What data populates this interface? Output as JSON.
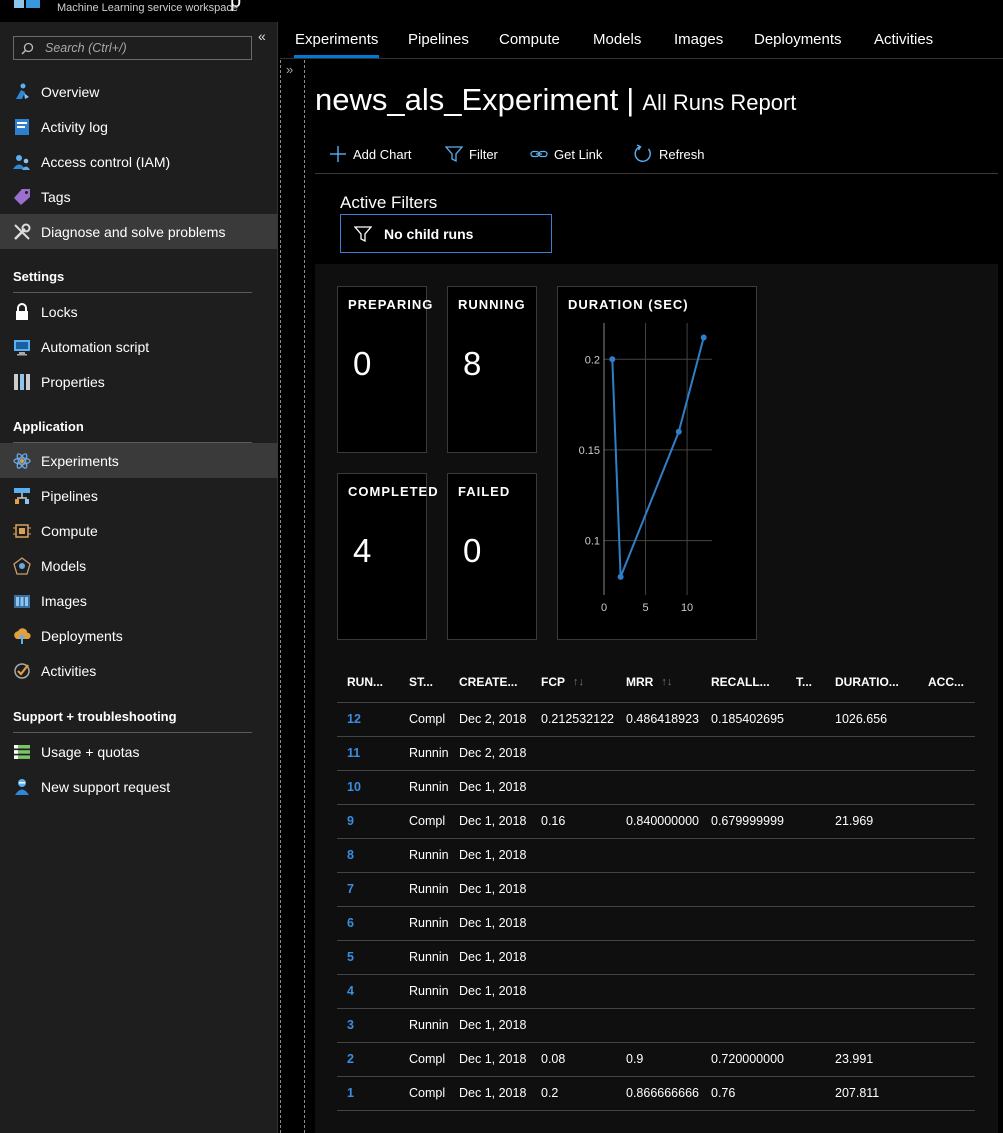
{
  "header": {
    "subtitle": "Machine Learning service workspace",
    "title_fragment": "p"
  },
  "sidebar": {
    "search_placeholder": "Search (Ctrl+/)",
    "collapse_glyph": "«",
    "items_top": [
      {
        "label": "Overview",
        "icon": "overview-icon"
      },
      {
        "label": "Activity log",
        "icon": "activity-log-icon"
      },
      {
        "label": "Access control (IAM)",
        "icon": "access-control-icon"
      },
      {
        "label": "Tags",
        "icon": "tag-icon"
      },
      {
        "label": "Diagnose and solve problems",
        "icon": "wrench-icon"
      }
    ],
    "settings": {
      "heading": "Settings",
      "items": [
        {
          "label": "Locks",
          "icon": "lock-icon"
        },
        {
          "label": "Automation script",
          "icon": "automation-script-icon"
        },
        {
          "label": "Properties",
          "icon": "properties-icon"
        }
      ]
    },
    "application": {
      "heading": "Application",
      "items": [
        {
          "label": "Experiments",
          "icon": "experiments-icon"
        },
        {
          "label": "Pipelines",
          "icon": "pipelines-icon"
        },
        {
          "label": "Compute",
          "icon": "compute-icon"
        },
        {
          "label": "Models",
          "icon": "models-icon"
        },
        {
          "label": "Images",
          "icon": "images-icon"
        },
        {
          "label": "Deployments",
          "icon": "deployments-icon"
        },
        {
          "label": "Activities",
          "icon": "activities-icon"
        }
      ]
    },
    "support": {
      "heading": "Support + troubleshooting",
      "items": [
        {
          "label": "Usage + quotas",
          "icon": "usage-quotas-icon"
        },
        {
          "label": "New support request",
          "icon": "support-request-icon"
        }
      ]
    }
  },
  "tabs": [
    "Experiments",
    "Pipelines",
    "Compute",
    "Models",
    "Images",
    "Deployments",
    "Activities"
  ],
  "active_tab": "Experiments",
  "splitter_glyph": "»",
  "page": {
    "title": "news_als_Experiment",
    "separator": "|",
    "subtitle": "All Runs Report"
  },
  "toolbar": {
    "add_chart": "Add Chart",
    "filter": "Filter",
    "get_link": "Get Link",
    "refresh": "Refresh"
  },
  "filters": {
    "label": "Active Filters",
    "chip": "No child runs"
  },
  "tiles": {
    "preparing": {
      "label": "PREPARING",
      "value": "0"
    },
    "running": {
      "label": "RUNNING",
      "value": "8"
    },
    "completed": {
      "label": "COMPLETED",
      "value": "4"
    },
    "failed": {
      "label": "FAILED",
      "value": "0"
    }
  },
  "chart_data": {
    "type": "line",
    "title": "DURATION (SEC)",
    "x": [
      1,
      2,
      9,
      12
    ],
    "y": [
      0.2,
      0.08,
      0.16,
      0.212
    ],
    "xticks": [
      "0",
      "5",
      "10"
    ],
    "yticks": [
      "0.1",
      "0.15",
      "0.2"
    ],
    "xlim": [
      0,
      13
    ],
    "ylim": [
      0.07,
      0.22
    ],
    "grid": true,
    "color": "#2f7fc8"
  },
  "table": {
    "headers": [
      {
        "label": "RUN...",
        "sortable": false
      },
      {
        "label": "ST...",
        "sortable": false
      },
      {
        "label": "CREATE...",
        "sortable": false
      },
      {
        "label": "FCP",
        "sortable": true
      },
      {
        "label": "MRR",
        "sortable": true
      },
      {
        "label": "RECALL...",
        "sortable": false
      },
      {
        "label": "T...",
        "sortable": false
      },
      {
        "label": "DURATIO...",
        "sortable": false
      },
      {
        "label": "ACC...",
        "sortable": false
      }
    ],
    "sort_glyph": "↑↓",
    "rows": [
      {
        "run": "12",
        "status": "Compl",
        "created": "Dec 2, 2018",
        "fcp": "0.212532122",
        "mrr": "0.486418923",
        "recall": "0.185402695",
        "t": "",
        "duration": "1026.656",
        "acc": ""
      },
      {
        "run": "11",
        "status": "Runnin",
        "created": "Dec 2, 2018",
        "fcp": "",
        "mrr": "",
        "recall": "",
        "t": "",
        "duration": "",
        "acc": ""
      },
      {
        "run": "10",
        "status": "Runnin",
        "created": "Dec 1, 2018",
        "fcp": "",
        "mrr": "",
        "recall": "",
        "t": "",
        "duration": "",
        "acc": ""
      },
      {
        "run": "9",
        "status": "Compl",
        "created": "Dec 1, 2018",
        "fcp": "0.16",
        "mrr": "0.840000000",
        "recall": "0.679999999",
        "t": "",
        "duration": "21.969",
        "acc": ""
      },
      {
        "run": "8",
        "status": "Runnin",
        "created": "Dec 1, 2018",
        "fcp": "",
        "mrr": "",
        "recall": "",
        "t": "",
        "duration": "",
        "acc": ""
      },
      {
        "run": "7",
        "status": "Runnin",
        "created": "Dec 1, 2018",
        "fcp": "",
        "mrr": "",
        "recall": "",
        "t": "",
        "duration": "",
        "acc": ""
      },
      {
        "run": "6",
        "status": "Runnin",
        "created": "Dec 1, 2018",
        "fcp": "",
        "mrr": "",
        "recall": "",
        "t": "",
        "duration": "",
        "acc": ""
      },
      {
        "run": "5",
        "status": "Runnin",
        "created": "Dec 1, 2018",
        "fcp": "",
        "mrr": "",
        "recall": "",
        "t": "",
        "duration": "",
        "acc": ""
      },
      {
        "run": "4",
        "status": "Runnin",
        "created": "Dec 1, 2018",
        "fcp": "",
        "mrr": "",
        "recall": "",
        "t": "",
        "duration": "",
        "acc": ""
      },
      {
        "run": "3",
        "status": "Runnin",
        "created": "Dec 1, 2018",
        "fcp": "",
        "mrr": "",
        "recall": "",
        "t": "",
        "duration": "",
        "acc": ""
      },
      {
        "run": "2",
        "status": "Compl",
        "created": "Dec 1, 2018",
        "fcp": "0.08",
        "mrr": "0.9",
        "recall": "0.720000000",
        "t": "",
        "duration": "23.991",
        "acc": ""
      },
      {
        "run": "1",
        "status": "Compl",
        "created": "Dec 1, 2018",
        "fcp": "0.2",
        "mrr": "0.866666666",
        "recall": "0.76",
        "t": "",
        "duration": "207.811",
        "acc": ""
      }
    ]
  },
  "colors": {
    "accent": "#0078d4",
    "link": "#3b8de0",
    "sidebar_bg": "#1e1e1e",
    "active_item": "#3a3a3a"
  }
}
